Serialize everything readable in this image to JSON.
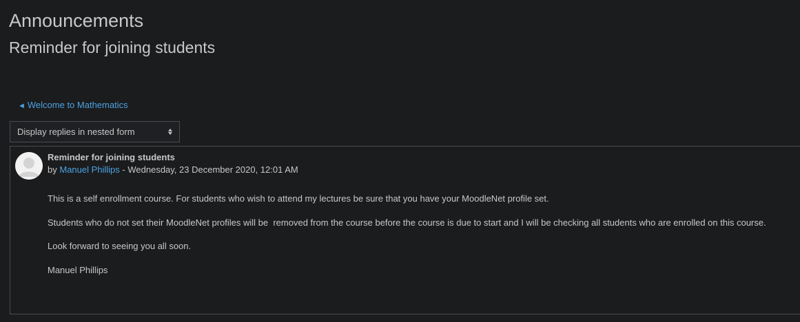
{
  "page": {
    "heading": "Announcements",
    "subheading": "Reminder for joining students"
  },
  "navigation": {
    "prev_arrow": "◄",
    "prev_label": "Welcome to Mathematics"
  },
  "display_mode": {
    "selected": "Display replies in nested form"
  },
  "post": {
    "title": "Reminder for joining students",
    "by_prefix": "by",
    "author": "Manuel Phillips",
    "date_sep": " - ",
    "date": "Wednesday, 23 December 2020, 12:01 AM",
    "paragraphs": [
      "This is a self enrollment course. For students who wish to attend my lectures be sure that you have your MoodleNet profile set.",
      "Students who do not set their MoodleNet profiles will be  removed from the course before the course is due to start and I will be checking all students who are enrolled on this course.",
      "Look forward to seeing you all soon.",
      "Manuel Phillips"
    ]
  }
}
